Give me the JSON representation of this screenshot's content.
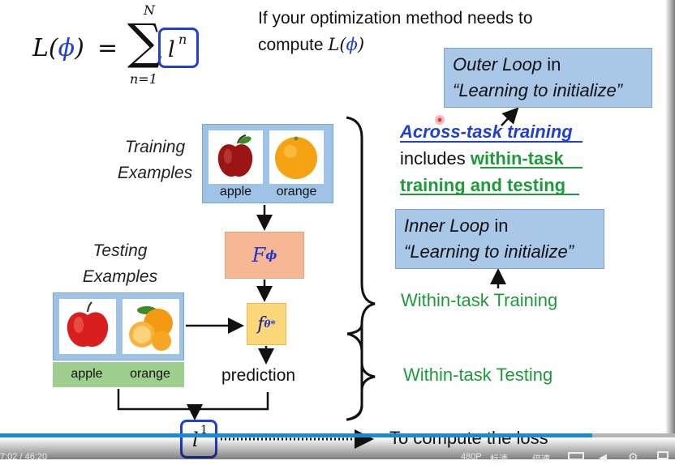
{
  "formula": {
    "lhs": "L(",
    "phi": "ϕ",
    "close": ")",
    "eq": "=",
    "sum": "∑",
    "upper": "N",
    "lower": "n=1",
    "term_l": "l",
    "term_sup": "n"
  },
  "note": {
    "line1": "If your optimization method needs to",
    "line2_prefix": "compute ",
    "line2_l": "L(",
    "line2_phi": "ϕ",
    "line2_close": ")"
  },
  "training": {
    "caption_line1": "Training",
    "caption_line2": "Examples",
    "apple": "apple",
    "orange": "orange"
  },
  "testing": {
    "caption_line1": "Testing",
    "caption_line2": "Examples",
    "apple": "apple",
    "orange": "orange"
  },
  "F_box": {
    "symbol": "F",
    "sub": "ϕ"
  },
  "f_box": {
    "symbol": "f",
    "sub": "θ*"
  },
  "prediction": "prediction",
  "loss": {
    "l": "l",
    "sup": "1",
    "text": "To compute the loss"
  },
  "outer_loop": {
    "line1_italic": "Outer Loop",
    "line1_rest": " in",
    "line2": "“Learning to initialize”"
  },
  "inner_loop": {
    "line1_italic": "Inner Loop",
    "line1_rest": " in",
    "line2": "“Learning to initialize”"
  },
  "across": {
    "title": "Across-task training",
    "includes": "includes ",
    "within1": "within-task",
    "within2": "training and testing"
  },
  "within_training": "Within-task Training",
  "within_testing": "Within-task Testing",
  "player": {
    "time": "7:02 / 46:20",
    "quality": "480P",
    "label1": "标清",
    "speed": "倍速",
    "progress": 0.878
  },
  "colors": {
    "blue": "#1f3fd6",
    "green": "#1e9a3a",
    "panel_blue": "#9ec3e6",
    "F_box": "#f6b894",
    "f_box": "#fbd77a",
    "progress": "#1a8ad8"
  }
}
